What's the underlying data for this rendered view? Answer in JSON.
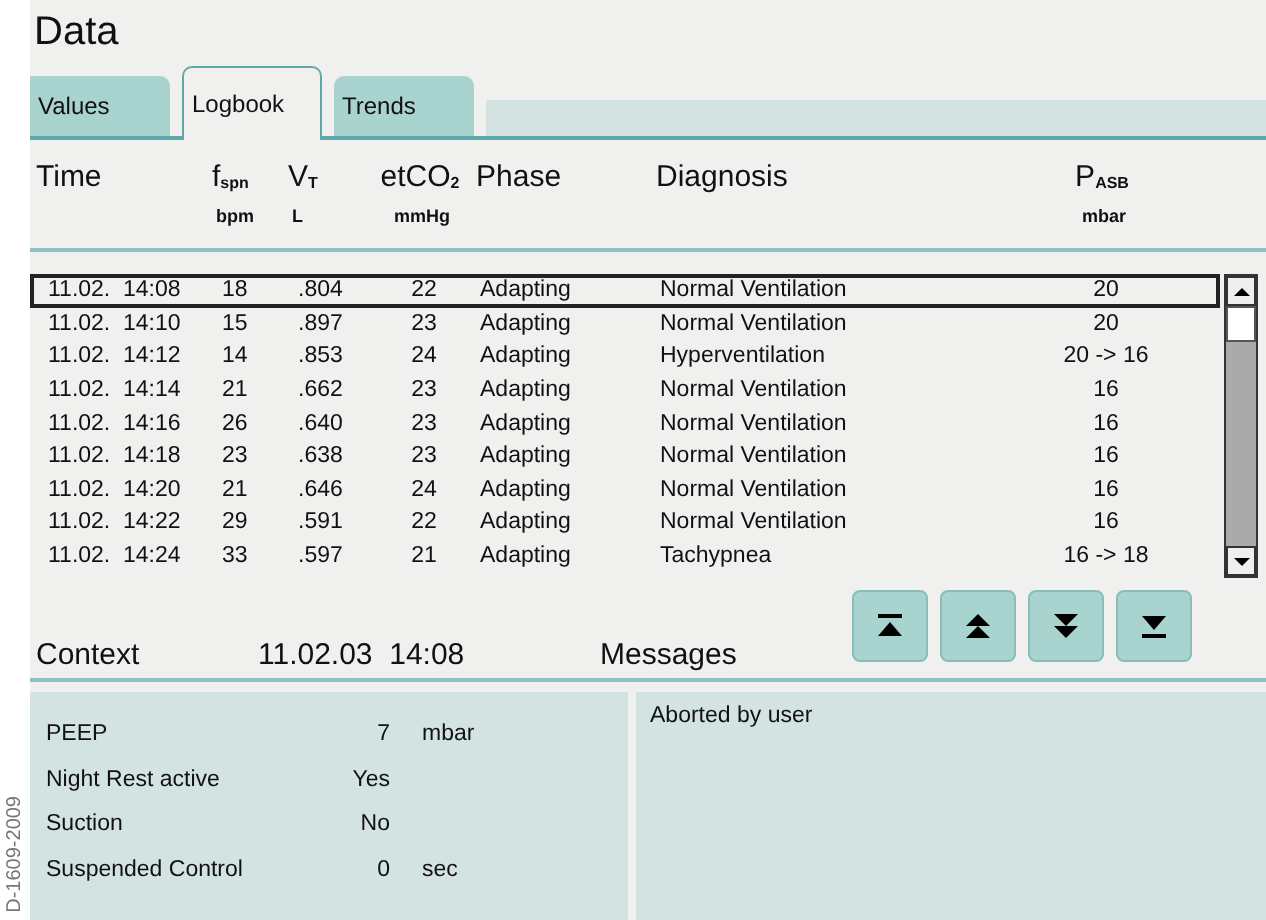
{
  "figure_label": "D-1609-2009",
  "window": {
    "title": "Data"
  },
  "tabs": [
    {
      "label": "Values",
      "selected": false
    },
    {
      "label": "Logbook",
      "selected": true
    },
    {
      "label": "Trends",
      "selected": false
    }
  ],
  "table": {
    "columns": [
      {
        "name": "Time"
      },
      {
        "name": "f$_{spn}$",
        "unit": "bpm"
      },
      {
        "name": "V$_{T}$",
        "unit": "L"
      },
      {
        "name": "etCO$_{2}$",
        "unit": "mmHg"
      },
      {
        "name": "Phase"
      },
      {
        "name": "Diagnosis"
      },
      {
        "name": "P$_{ASB}$",
        "unit": "mbar"
      }
    ],
    "rows": [
      {
        "cells": [
          "11.02.  14:08",
          "18",
          ".804",
          "22",
          "Adapting",
          "Normal Ventilation",
          "20"
        ],
        "selected": true
      },
      {
        "cells": [
          "11.02.  14:10",
          "15",
          ".897",
          "23",
          "Adapting",
          "Normal Ventilation",
          "20"
        ],
        "selected": false
      },
      {
        "cells": [
          "11.02.  14:12",
          "14",
          ".853",
          "24",
          "Adapting",
          "Hyperventilation",
          "20 -> 16"
        ],
        "selected": false
      },
      {
        "cells": [
          "11.02.  14:14",
          "21",
          ".662",
          "23",
          "Adapting",
          "Normal Ventilation",
          "16"
        ],
        "selected": false
      },
      {
        "cells": [
          "11.02.  14:16",
          "26",
          ".640",
          "23",
          "Adapting",
          "Normal Ventilation",
          "16"
        ],
        "selected": false
      },
      {
        "cells": [
          "11.02.  14:18",
          "23",
          ".638",
          "23",
          "Adapting",
          "Normal Ventilation",
          "16"
        ],
        "selected": false
      },
      {
        "cells": [
          "11.02.  14:20",
          "21",
          ".646",
          "24",
          "Adapting",
          "Normal Ventilation",
          "16"
        ],
        "selected": false
      },
      {
        "cells": [
          "11.02.  14:22",
          "29",
          ".591",
          "22",
          "Adapting",
          "Normal Ventilation",
          "16"
        ],
        "selected": false
      },
      {
        "cells": [
          "11.02.  14:24",
          "33",
          ".597",
          "21",
          "Adapting",
          "Tachypnea",
          "16 -> 18"
        ],
        "selected": false
      }
    ]
  },
  "nav_buttons": [
    {
      "kind": "first"
    },
    {
      "kind": "page-up"
    },
    {
      "kind": "page-down"
    },
    {
      "kind": "last"
    }
  ],
  "context": {
    "label": "Context",
    "timestamp": "11.02.03  14:08",
    "items": [
      {
        "label": "PEEP",
        "value": "7",
        "unit": "mbar"
      },
      {
        "label": "Night Rest active",
        "value": "Yes"
      },
      {
        "label": "Suction",
        "value": "No"
      },
      {
        "label": "Suspended Control",
        "value": "0",
        "unit": "sec"
      }
    ]
  },
  "messages": {
    "label": "Messages",
    "items": [
      "Aborted by user"
    ]
  }
}
